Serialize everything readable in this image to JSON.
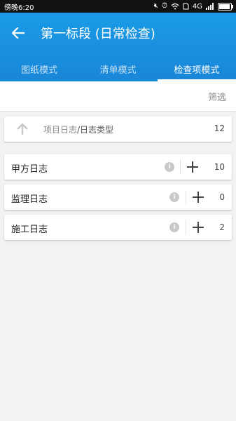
{
  "status_bar": {
    "time": "傍晚6:20",
    "network": "4G",
    "battery_level": 0.85
  },
  "app_bar": {
    "title": "第一标段 (日常检查)"
  },
  "tabs": [
    {
      "label": "图纸模式",
      "active": false
    },
    {
      "label": "清单模式",
      "active": false
    },
    {
      "label": "检查项模式",
      "active": true
    }
  ],
  "filter": {
    "label": "筛选"
  },
  "parent": {
    "path_part1": "项目日志",
    "path_part2": "/日志类型",
    "count": "12"
  },
  "items": [
    {
      "title": "甲方日志",
      "count": "10"
    },
    {
      "title": "监理日志",
      "count": "0"
    },
    {
      "title": "施工日志",
      "count": "2"
    }
  ],
  "colors": {
    "accent": "#1a8fe0",
    "background": "#f2f2f2"
  }
}
